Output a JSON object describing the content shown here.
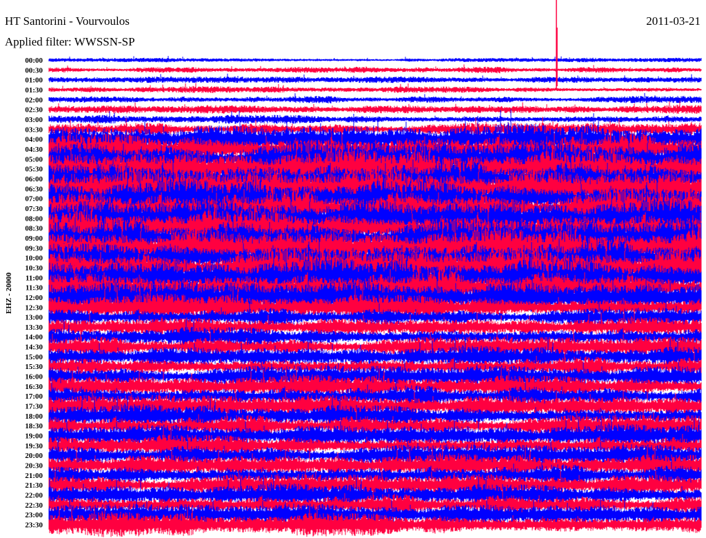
{
  "header": {
    "title": "HT Santorini - Vourvoulos",
    "filter": "Applied filter: WWSSN-SP",
    "date": "2011-03-21"
  },
  "chart_data": {
    "type": "line",
    "title": "HT Santorini - Vourvoulos",
    "ylabel": "EHZ - 20000",
    "colors": [
      "#0000ff",
      "#ff0040"
    ],
    "grid": false,
    "rows": [
      "00:00",
      "00:30",
      "01:00",
      "01:30",
      "02:00",
      "02:30",
      "03:00",
      "03:30",
      "04:00",
      "04:30",
      "05:00",
      "05:30",
      "06:00",
      "06:30",
      "07:00",
      "07:30",
      "08:00",
      "08:30",
      "09:00",
      "09:30",
      "10:00",
      "10:30",
      "11:00",
      "11:30",
      "12:00",
      "12:30",
      "13:00",
      "13:30",
      "14:00",
      "14:30",
      "15:00",
      "15:30",
      "16:00",
      "16:30",
      "17:00",
      "17:30",
      "18:00",
      "18:30",
      "19:00",
      "19:30",
      "20:00",
      "20:30",
      "21:00",
      "21:30",
      "22:00",
      "22:30",
      "23:00",
      "23:30"
    ],
    "relative_amplitude": [
      0.25,
      0.35,
      0.35,
      0.35,
      0.4,
      0.45,
      0.5,
      0.7,
      1.6,
      1.8,
      1.9,
      2.0,
      2.0,
      2.0,
      2.0,
      2.0,
      2.0,
      2.0,
      2.0,
      2.0,
      2.0,
      2.0,
      2.0,
      1.9,
      1.7,
      1.4,
      1.0,
      1.0,
      1.1,
      1.1,
      1.1,
      1.1,
      1.2,
      1.2,
      1.2,
      1.2,
      1.2,
      1.2,
      1.2,
      1.2,
      1.2,
      1.2,
      1.2,
      1.2,
      1.2,
      1.2,
      1.2,
      1.3
    ]
  }
}
